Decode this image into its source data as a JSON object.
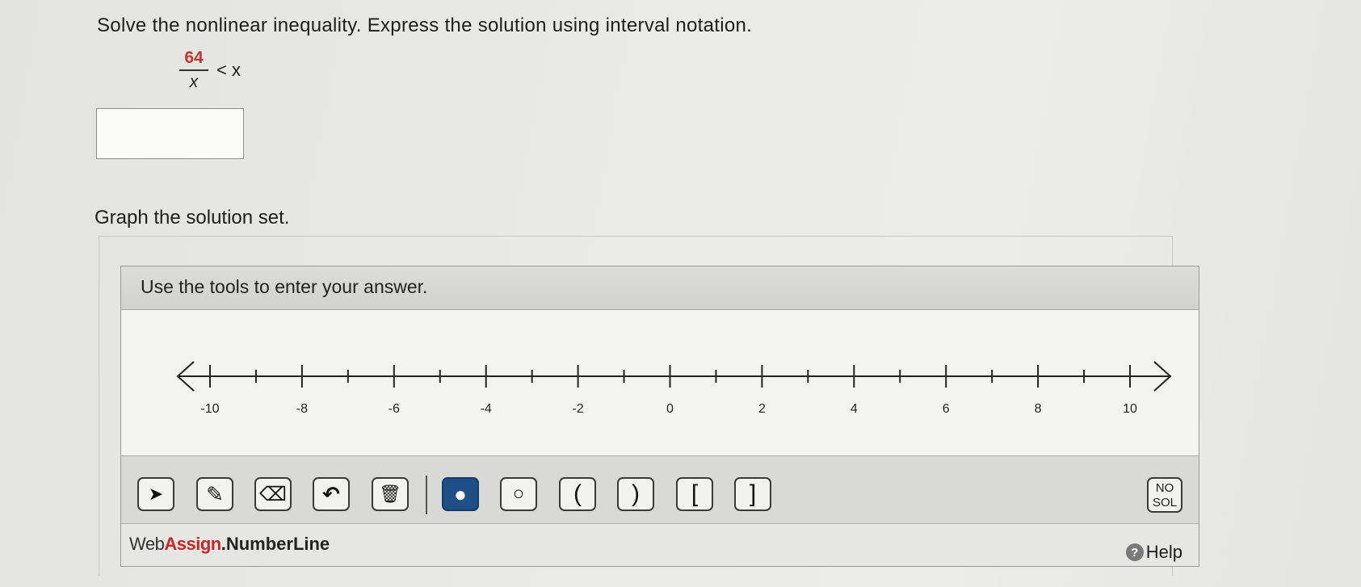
{
  "question": {
    "text": "Solve the nonlinear inequality. Express the solution using interval notation.",
    "numerator": "64",
    "denominator": "x",
    "inequality": "< x"
  },
  "answer_input": {
    "value": ""
  },
  "graph_prompt": "Graph the solution set.",
  "tool_panel": {
    "header": "Use the tools to enter your answer.",
    "number_line": {
      "min": -10,
      "max": 10,
      "minor_step": 1,
      "labels": [
        "-10",
        "-8",
        "-6",
        "-4",
        "-2",
        "0",
        "2",
        "4",
        "6",
        "8",
        "10"
      ]
    },
    "tools": [
      {
        "name": "pointer-tool",
        "glyph": "➤"
      },
      {
        "name": "pencil-tool",
        "glyph": "✎"
      },
      {
        "name": "eraser-tool",
        "glyph": "⌫"
      },
      {
        "name": "undo-tool",
        "glyph": "↶"
      },
      {
        "name": "trash-tool",
        "glyph": "🗑"
      },
      {
        "name": "closed-point-tool",
        "glyph": "●"
      },
      {
        "name": "open-point-tool",
        "glyph": "○"
      },
      {
        "name": "left-paren-tool",
        "glyph": "("
      },
      {
        "name": "right-paren-tool",
        "glyph": ")"
      },
      {
        "name": "left-bracket-tool",
        "glyph": "["
      },
      {
        "name": "right-bracket-tool",
        "glyph": "]"
      }
    ],
    "no_solution": {
      "line1": "NO",
      "line2": "SOL"
    },
    "brand": {
      "part1": "Web",
      "part2": "Assign",
      "part3": ".NumberLine"
    },
    "help_label": "Help",
    "colors": {
      "active_tool": "#1f4f86",
      "brand_red": "#c62828"
    }
  }
}
